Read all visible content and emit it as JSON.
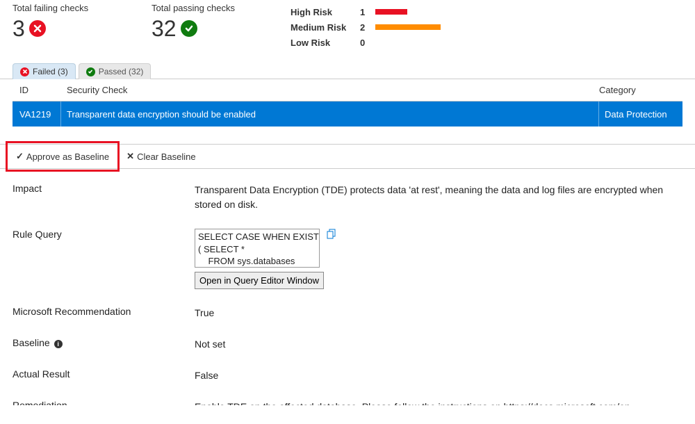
{
  "summary": {
    "failing_label": "Total failing checks",
    "failing_count": "3",
    "passing_label": "Total passing checks",
    "passing_count": "32",
    "risk": {
      "high_label": "High Risk",
      "high_count": "1",
      "medium_label": "Medium Risk",
      "medium_count": "2",
      "low_label": "Low Risk",
      "low_count": "0"
    }
  },
  "tabs": {
    "failed": "Failed  (3)",
    "passed": "Passed  (32)"
  },
  "table": {
    "headers": {
      "id": "ID",
      "check": "Security Check",
      "category": "Category"
    },
    "row": {
      "id": "VA1219",
      "check": "Transparent data encryption should be enabled",
      "category": "Data Protection"
    }
  },
  "actions": {
    "approve": "Approve as Baseline",
    "clear": "Clear Baseline"
  },
  "details": {
    "impact_label": "Impact",
    "impact_value": "Transparent Data Encryption (TDE) protects data 'at rest', meaning the data and log files are encrypted when stored on disk.",
    "rule_query_label": "Rule Query",
    "rule_query_value": "SELECT CASE WHEN EXISTS\n( SELECT *\n    FROM sys.databases",
    "open_query_btn": "Open in Query Editor Window",
    "msrec_label": "Microsoft Recommendation",
    "msrec_value": "True",
    "baseline_label": "Baseline",
    "baseline_value": "Not set",
    "actual_label": "Actual Result",
    "actual_value": "False",
    "remediation_label": "Remediation",
    "remediation_value": "Enable TDE on the affected database. Please follow the instructions on https://docs.microsoft.com/en-us/sql/relational-databases/security/encryption/transparent-data-encryption"
  }
}
